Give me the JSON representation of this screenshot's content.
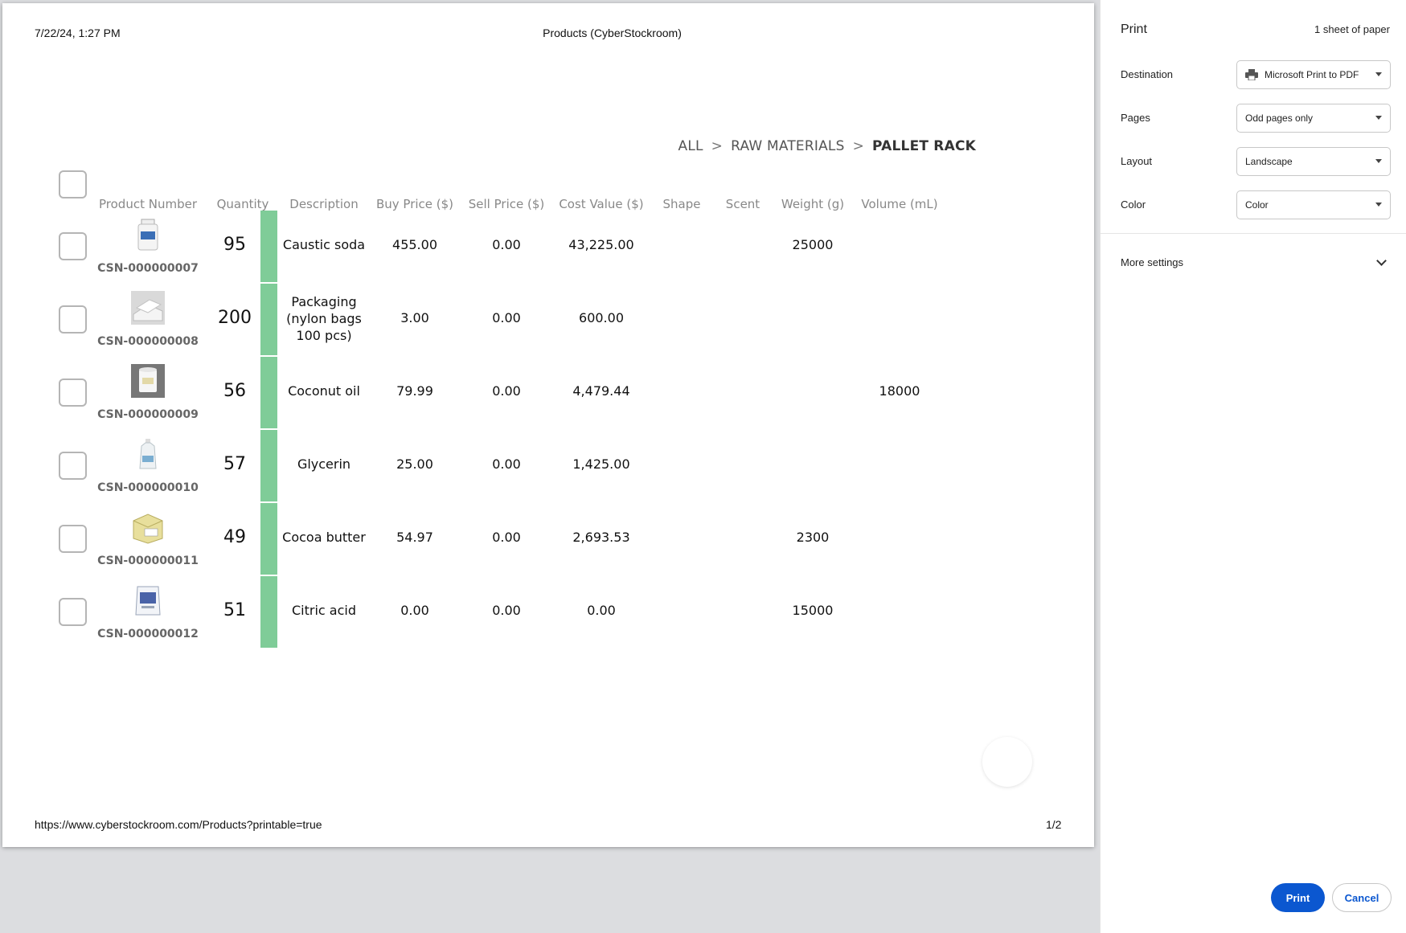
{
  "page": {
    "header_date": "7/22/24, 1:27 PM",
    "header_title": "Products (CyberStockroom)",
    "footer_url": "https://www.cyberstockroom.com/Products?printable=true",
    "footer_page": "1/2"
  },
  "breadcrumb": {
    "items": [
      "ALL",
      "RAW MATERIALS",
      "PALLET RACK"
    ],
    "separator": ">"
  },
  "table": {
    "columns": [
      "Product Number",
      "Quantity",
      "Description",
      "Buy Price ($)",
      "Sell Price ($)",
      "Cost Value ($)",
      "Shape",
      "Scent",
      "Weight (g)",
      "Volume (mL)"
    ],
    "rows": [
      {
        "product_number": "CSN-000000007",
        "quantity": "95",
        "description": "Caustic soda",
        "buy_price": "455.00",
        "sell_price": "0.00",
        "cost_value": "43,225.00",
        "shape": "",
        "scent": "",
        "weight": "25000",
        "volume": "",
        "thumb": "jar-icon"
      },
      {
        "product_number": "CSN-000000008",
        "quantity": "200",
        "description": "Packaging (nylon bags 100 pcs)",
        "buy_price": "3.00",
        "sell_price": "0.00",
        "cost_value": "600.00",
        "shape": "",
        "scent": "",
        "weight": "",
        "volume": "",
        "thumb": "bags-icon"
      },
      {
        "product_number": "CSN-000000009",
        "quantity": "56",
        "description": "Coconut oil",
        "buy_price": "79.99",
        "sell_price": "0.00",
        "cost_value": "4,479.44",
        "shape": "",
        "scent": "",
        "weight": "",
        "volume": "18000",
        "thumb": "bucket-icon"
      },
      {
        "product_number": "CSN-000000010",
        "quantity": "57",
        "description": "Glycerin",
        "buy_price": "25.00",
        "sell_price": "0.00",
        "cost_value": "1,425.00",
        "shape": "",
        "scent": "",
        "weight": "",
        "volume": "",
        "thumb": "jug-icon"
      },
      {
        "product_number": "CSN-000000011",
        "quantity": "49",
        "description": "Cocoa butter",
        "buy_price": "54.97",
        "sell_price": "0.00",
        "cost_value": "2,693.53",
        "shape": "",
        "scent": "",
        "weight": "2300",
        "volume": "",
        "thumb": "box-icon"
      },
      {
        "product_number": "CSN-000000012",
        "quantity": "51",
        "description": "Citric acid",
        "buy_price": "0.00",
        "sell_price": "0.00",
        "cost_value": "0.00",
        "shape": "",
        "scent": "",
        "weight": "15000",
        "volume": "",
        "thumb": "sack-icon"
      }
    ]
  },
  "print_panel": {
    "title": "Print",
    "sheet_count": "1 sheet of paper",
    "settings": [
      {
        "label": "Destination",
        "value": "Microsoft Print to PDF"
      },
      {
        "label": "Pages",
        "value": "Odd pages only"
      },
      {
        "label": "Layout",
        "value": "Landscape"
      },
      {
        "label": "Color",
        "value": "Color"
      }
    ],
    "more_settings": "More settings",
    "print_label": "Print",
    "cancel_label": "Cancel"
  },
  "colors": {
    "quantity_bar": "#7fcc98",
    "primary_button": "#0b57d0"
  }
}
